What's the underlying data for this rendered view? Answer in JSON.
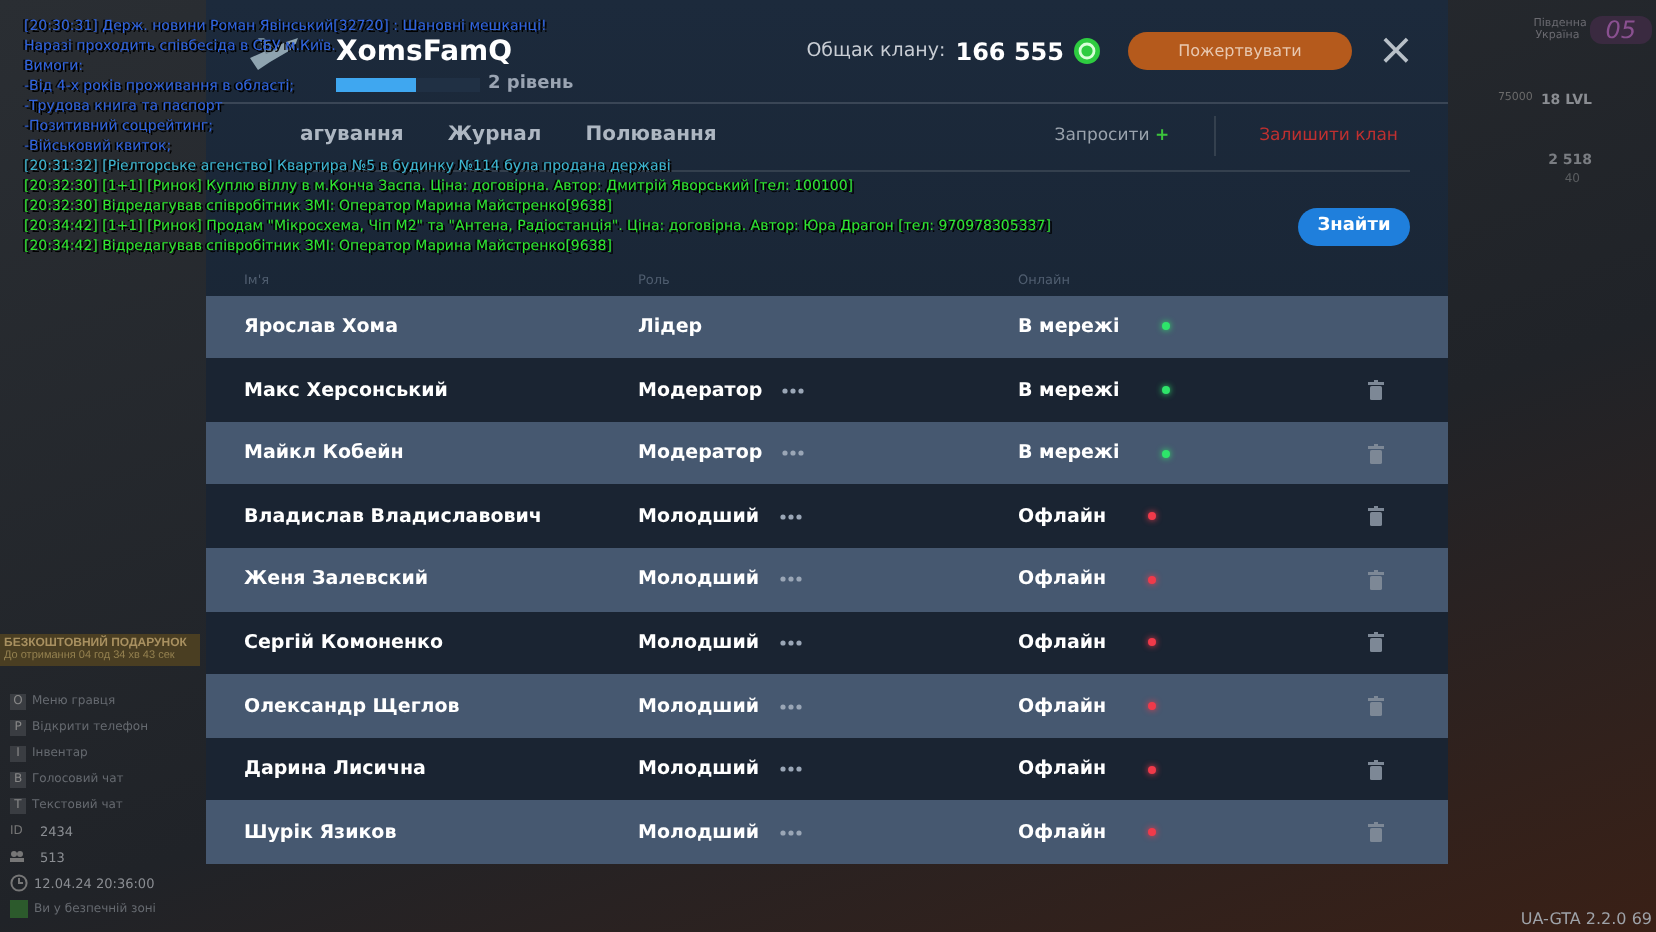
{
  "chat": [
    {
      "text": "[20:30:31] Держ. новини Роман Явінський[32720] : Шановні мешканці!",
      "color": "#2f63e0"
    },
    {
      "text": "Наразі проходить співбесіда в СБУ м.Київ.",
      "color": "#2f63e0"
    },
    {
      "text": "Вимоги:",
      "color": "#2f63e0"
    },
    {
      "text": "-Від 4-х років проживання в області;",
      "color": "#2f63e0"
    },
    {
      "text": "-Трудова книга та паспорт",
      "color": "#2f63e0"
    },
    {
      "text": "-Позитивний соцрейтинг;",
      "color": "#2f63e0"
    },
    {
      "text": "-Військовий квиток;",
      "color": "#2f63e0"
    },
    {
      "text": "[20:31:32] [Ріелторське агенство] Квартира №5 в будинку №114 була продана державі",
      "color": "#3cb6d0"
    },
    {
      "text": "[20:32:30] [1+1] [Ринок] Куплю віллу в м.Конча Заспа. Ціна: договірна. Автор: Дмитрій Яворський [тел: 100100]",
      "color": "#2ee62e"
    },
    {
      "text": "[20:32:30]  Відредагував співробітник ЗМІ: Оператор Марина Майстренко[9638]",
      "color": "#2ee62e"
    },
    {
      "text": "[20:34:42] [1+1] [Ринок] Продам \"Мікросхема, Чіп М2\" та \"Антена, Радіостанція\". Ціна: договірна. Автор: Юра Драгон [тел: 970978305337]",
      "color": "#2ee62e"
    },
    {
      "text": "[20:34:42]  Відредагував співробітник ЗМІ: Оператор Марина Майстренко[9638]",
      "color": "#2ee62e"
    }
  ],
  "clan": {
    "name": "XomsFamQ",
    "level": 0.55,
    "level_label": "2 рівень",
    "bank_label": "Общак клану:",
    "bank_amount": "166 555",
    "donate_button": "Пожертвувати",
    "close": "×"
  },
  "tabs": [
    {
      "label": "агування",
      "selected": false
    },
    {
      "label": "Журнал",
      "selected": false
    },
    {
      "label": "Полювання",
      "selected": false
    }
  ],
  "invite": {
    "label": "Запросити",
    "icon": "+"
  },
  "leave_button": "Залишити клан",
  "search_button": "Знайти",
  "table": {
    "columns": [
      "Ім'я",
      "Роль",
      "Онлайн"
    ],
    "rows": [
      {
        "name": "Ярослав Хома",
        "role": "Лідер",
        "has_menu": false,
        "status": "В мережі",
        "online": true,
        "removable": false
      },
      {
        "name": "Макс Херсонський",
        "role": "Модератор",
        "has_menu": true,
        "status": "В мережі",
        "online": true,
        "removable": true
      },
      {
        "name": "Майкл Кобейн",
        "role": "Модератор",
        "has_menu": true,
        "status": "В мережі",
        "online": true,
        "removable": true
      },
      {
        "name": "Владислав Владиславович",
        "role": "Молодший",
        "has_menu": true,
        "status": "Офлайн",
        "online": false,
        "removable": true
      },
      {
        "name": "Женя Залевский",
        "role": "Молодший",
        "has_menu": true,
        "status": "Офлайн",
        "online": false,
        "removable": true
      },
      {
        "name": "Сергій Комоненко",
        "role": "Молодший",
        "has_menu": true,
        "status": "Офлайн",
        "online": false,
        "removable": true
      },
      {
        "name": "Олександр Щеглов",
        "role": "Молодший",
        "has_menu": true,
        "status": "Офлайн",
        "online": false,
        "removable": true
      },
      {
        "name": "Дарина Лисична",
        "role": "Молодший",
        "has_menu": true,
        "status": "Офлайн",
        "online": false,
        "removable": true
      },
      {
        "name": "Шурік Язиков",
        "role": "Молодший",
        "has_menu": true,
        "status": "Офлайн",
        "online": false,
        "removable": true
      }
    ]
  },
  "hud_left": {
    "gift_title": "БЕЗКОШТОВНИЙ ПОДАРУНОК",
    "gift_timer": "До отримання 04 год 34 хв 43 сек",
    "keys": [
      {
        "key": "O",
        "label": "Меню гравця"
      },
      {
        "key": "P",
        "label": "Відкрити телефон"
      },
      {
        "key": "I",
        "label": "Інвентар"
      },
      {
        "key": "B",
        "label": "Голосовий чат"
      },
      {
        "key": "T",
        "label": "Текстовий чат"
      }
    ],
    "id_label": "ID",
    "id": "2434",
    "players": "513",
    "datetime": "12.04.24 20:36:00",
    "zone": "Ви у безпечній зоні"
  },
  "hud_right": {
    "region": "Південна Україна",
    "region_number": "05",
    "xp": "75000",
    "lvl": "18 LVL",
    "money": "2 518",
    "coins": "40",
    "version": "UA-GTA 2.2.0 69"
  }
}
